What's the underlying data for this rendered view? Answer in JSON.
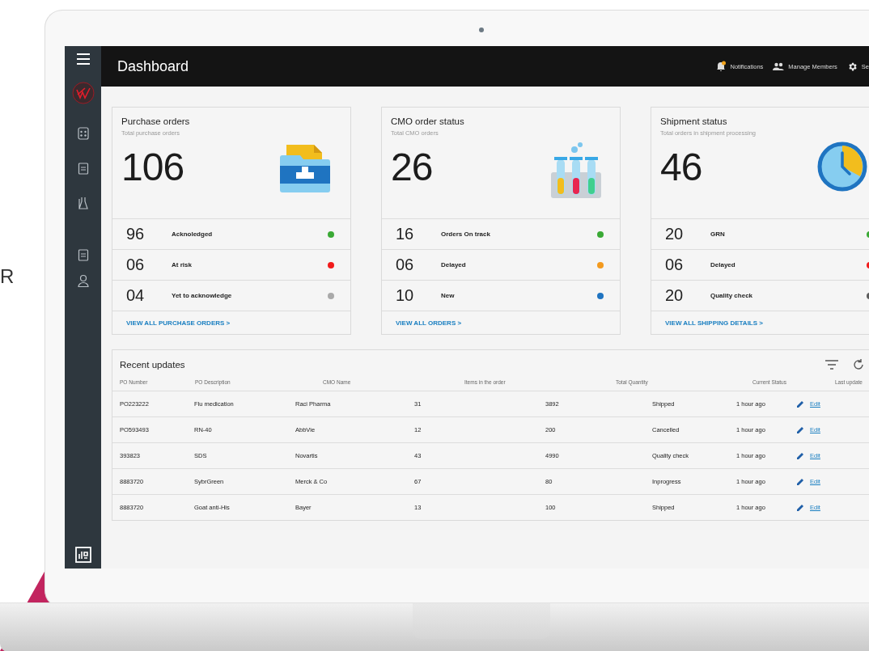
{
  "background_text": "R",
  "topbar": {
    "title": "Dashboard",
    "actions": [
      {
        "kind": "bell",
        "label": "Notifications"
      },
      {
        "kind": "people",
        "label": "Manage Members"
      },
      {
        "kind": "gear",
        "label": "Se"
      }
    ]
  },
  "cards": [
    {
      "title": "Purchase orders",
      "subtitle": "Total purchase orders",
      "total": "106",
      "kind": "folder",
      "stats": [
        {
          "value": "96",
          "label": "Acknoledged",
          "color": "#3aa935"
        },
        {
          "value": "06",
          "label": "At risk",
          "color": "#f11b1b"
        },
        {
          "value": "04",
          "label": "Yet to acknowledge",
          "color": "#a9a9a9"
        }
      ],
      "link": "VIEW ALL PURCHASE ORDERS >"
    },
    {
      "title": "CMO order status",
      "subtitle": "Total CMO orders",
      "total": "26",
      "kind": "tubes",
      "stats": [
        {
          "value": "16",
          "label": "Orders On track",
          "color": "#3aa935"
        },
        {
          "value": "06",
          "label": "Delayed",
          "color": "#f39a1e"
        },
        {
          "value": "10",
          "label": "New",
          "color": "#1f74c1"
        }
      ],
      "link": "VIEW ALL ORDERS >"
    },
    {
      "title": "Shipment status",
      "subtitle": "Total orders in shipment processing",
      "total": "46",
      "kind": "clock",
      "stats": [
        {
          "value": "20",
          "label": "GRN",
          "color": "#3aa935"
        },
        {
          "value": "06",
          "label": "Delayed",
          "color": "#f11b1b"
        },
        {
          "value": "20",
          "label": "Quality check",
          "color": "#5c5c5c"
        }
      ],
      "link": "VIEW ALL SHIPPING DETAILS >"
    }
  ],
  "recent_updates": {
    "title": "Recent updates",
    "columns": [
      "PO Number",
      "PO Description",
      "CMO Name",
      "Items in the order",
      "Total Quantity",
      "Current Status",
      "Last update"
    ],
    "rows": [
      {
        "cells": [
          "PO223222",
          "Flu medication",
          "Raci Pharma",
          "31",
          "3892",
          "Shipped",
          "1 hour ago"
        ],
        "action": "Edit"
      },
      {
        "cells": [
          "PO593493",
          "RN-40",
          "AbbVie",
          "12",
          "200",
          "Cancelled",
          "1 hour ago"
        ],
        "action": "Edit"
      },
      {
        "cells": [
          "393823",
          "SDS",
          "Novartis",
          "43",
          "4990",
          "Quality check",
          "1 hour ago"
        ],
        "action": "Edit"
      },
      {
        "cells": [
          "8883720",
          "SybrGreen",
          "Merck & Co",
          "67",
          "80",
          "Inprogress",
          "1 hour ago"
        ],
        "action": "Edit"
      },
      {
        "cells": [
          "8883720",
          "Goat anti-His",
          "Bayer",
          "13",
          "100",
          "Shipped",
          "1 hour ago"
        ],
        "action": "Edit"
      }
    ]
  }
}
